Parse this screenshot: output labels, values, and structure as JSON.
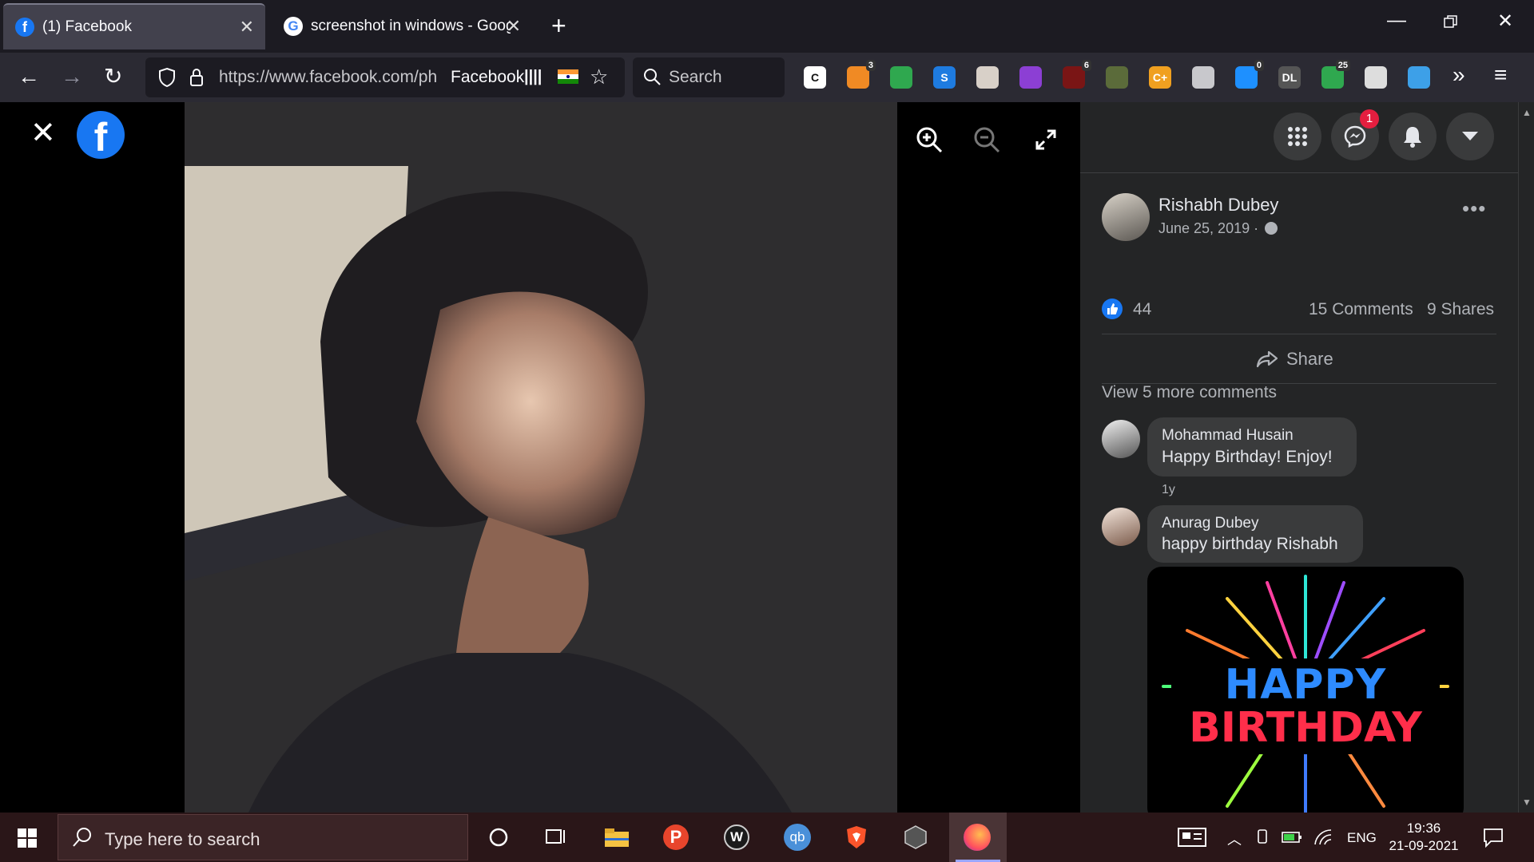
{
  "browser": {
    "tabs": [
      {
        "title": "(1) Facebook",
        "active": true
      },
      {
        "title": "screenshot in windows - Google"
      }
    ],
    "url": "https://www.facebook.com/ph",
    "site_label": "Facebook",
    "search_placeholder": "Search",
    "extensions": [
      {
        "name": "c-icon",
        "color": "#ffffff",
        "letter": "C"
      },
      {
        "name": "cup-icon",
        "color": "#f08a24",
        "badge": "3"
      },
      {
        "name": "refresh-ext-icon",
        "color": "#2fa84f"
      },
      {
        "name": "s-icon",
        "color": "#1e7be0",
        "letter": "S"
      },
      {
        "name": "hand-icon",
        "color": "#d8d0c8"
      },
      {
        "name": "hex-icon",
        "color": "#8c3fd4"
      },
      {
        "name": "ublock-icon",
        "color": "#7a1515",
        "badge": "6"
      },
      {
        "name": "check-icon",
        "color": "#5b6b3a"
      },
      {
        "name": "coupon-icon",
        "color": "#f0a020",
        "letter": "C+"
      },
      {
        "name": "bars-icon",
        "color": "#c8c8cc"
      },
      {
        "name": "bell-ext-icon",
        "color": "#1e90ff",
        "badge": "0"
      },
      {
        "name": "dl-icon",
        "color": "#555555",
        "letter": "DL"
      },
      {
        "name": "shield-ext-icon",
        "color": "#2fa84f",
        "badge": "25"
      },
      {
        "name": "face-icon",
        "color": "#dddddd"
      },
      {
        "name": "window-ext-icon",
        "color": "#3da0e8"
      }
    ]
  },
  "post": {
    "author": "Rishabh Dubey",
    "date": "June 25, 2019 ·",
    "likes": "44",
    "comments_count": "15 Comments",
    "shares_count": "9 Shares",
    "share_label": "Share",
    "view_more": "View 5 more comments",
    "messenger_badge": "1"
  },
  "comments": [
    {
      "author": "Mohammad Husain",
      "text": "Happy Birthday! Enjoy!",
      "time": "1y"
    },
    {
      "author": "Anurag Dubey",
      "text": "happy birthday Rishabh"
    }
  ],
  "gif": {
    "line1": "HAPPY",
    "line2": "BIRTHDAY"
  },
  "taskbar": {
    "search_placeholder": "Type here to search",
    "language": "ENG",
    "time": "19:36",
    "date": "21-09-2021"
  }
}
